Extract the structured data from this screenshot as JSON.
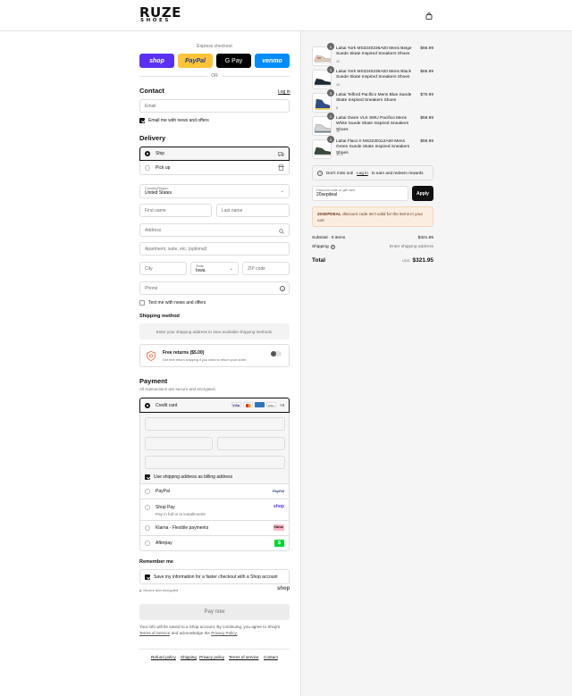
{
  "brand": {
    "line1": "RUZE",
    "line2": "SHOES"
  },
  "express": {
    "title": "Express checkout",
    "buttons": [
      {
        "label": "shop",
        "bg": "#5a31f4",
        "fg": "#ffffff"
      },
      {
        "label": "PayPal",
        "bg": "#ffc439",
        "fg": "#253b80"
      },
      {
        "label": "G Pay",
        "bg": "#000000",
        "fg": "#ffffff"
      },
      {
        "label": "venmo",
        "bg": "#008cff",
        "fg": "#ffffff"
      }
    ],
    "or": "OR"
  },
  "contact": {
    "heading": "Contact",
    "login": "Log in",
    "email_placeholder": "Email",
    "news_label": "Email me with news and offers"
  },
  "delivery": {
    "heading": "Delivery",
    "ship": "Ship",
    "pickup": "Pick up",
    "country_label": "Country/Region",
    "country_value": "United States",
    "first_name": "First name",
    "last_name": "Last name",
    "address": "Address",
    "apartment": "Apartment, suite, etc. (optional)",
    "city": "City",
    "state_label": "State",
    "state_value": "Iowa",
    "zip": "ZIP code",
    "phone": "Phone",
    "text_news": "Text me with news and offers"
  },
  "shipping": {
    "heading": "Shipping method",
    "notice": "Enter your shipping address to view available shipping methods.",
    "returns_title": "Free returns ($5.00)",
    "returns_sub": "Get free return shipping if you need to return your order."
  },
  "payment": {
    "heading": "Payment",
    "sub": "All transactions are secure and encrypted.",
    "credit_card": "Credit card",
    "card_more": "+4",
    "billing_label": "Use shipping address as billing address",
    "options": [
      {
        "label": "PayPal",
        "sub": "",
        "badge": "PayPal"
      },
      {
        "label": "Shop Pay",
        "sub": "Pay in full or in installments",
        "badge": "shop"
      },
      {
        "label": "Klarna - Flexible payments",
        "sub": "",
        "badge": "Klarna."
      },
      {
        "label": "Afterpay",
        "sub": "",
        "badge": "$"
      }
    ]
  },
  "remember": {
    "heading": "Remember me",
    "save_label": "Save my information for a faster checkout with a Shop account",
    "secure": "Secure and encrypted",
    "shop": "shop"
  },
  "pay_button": "Pay now",
  "legal": {
    "text1": "Your info will be saved to a Shop account. By continuing, you agree to Shop's",
    "terms": "Terms of Service",
    "and": "and acknowledge the",
    "privacy": "Privacy Policy."
  },
  "footer_links": [
    "Refund policy",
    "Shipping",
    "Privacy policy",
    "Terms of service",
    "Contact"
  ],
  "cart": {
    "items": [
      {
        "qty": "1",
        "name": "Lakai York MS3240236A00 Mens Beige Suede Skate Inspired Sneakers Shoes",
        "size": "11",
        "price": "$66.99",
        "shoe_color": "#d9cdb8"
      },
      {
        "qty": "1",
        "name": "Lakai York MS3240236A00 Mens Black Suede Skate Inspired Sneakers Shoes",
        "size": "10",
        "price": "$65.99",
        "shoe_color": "#1f2a36"
      },
      {
        "qty": "1",
        "name": "Lakai Telford Pacifico Mens Blue Suede Skate Inspired Sneakers Shoes",
        "size": "8",
        "price": "$70.99",
        "shoe_color": "#2f4d8a"
      },
      {
        "qty": "1",
        "name": "Lakai Owen VLK SMU Pacifico Mens White Suede Skate Inspired Sneakers Shoes",
        "size": "10",
        "price": "$58.99",
        "shoe_color": "#cfd3d6"
      },
      {
        "qty": "1",
        "name": "Lakai Flaco II MS3230112A00 Mens Green Suede Skate Inspired Sneakers Shoes",
        "size": "10.5",
        "price": "$58.99",
        "shoe_color": "#3b4a3c"
      }
    ],
    "missout_pre": "Don't miss out!",
    "missout_link": "Log in",
    "missout_post": "to earn and redeem rewards",
    "discount_label": "Discount code or gift card",
    "discount_value": "20sepdeal",
    "apply": "Apply",
    "error_code": "20SEPDEAL",
    "error_text": "discount code isn't valid for the items in your cart",
    "subtotal_label": "Subtotal · 5 items",
    "subtotal_value": "$321.95",
    "shipping_label": "Shipping",
    "shipping_value": "Enter shipping address",
    "total_label": "Total",
    "currency": "USD",
    "total_value": "$321.95"
  }
}
